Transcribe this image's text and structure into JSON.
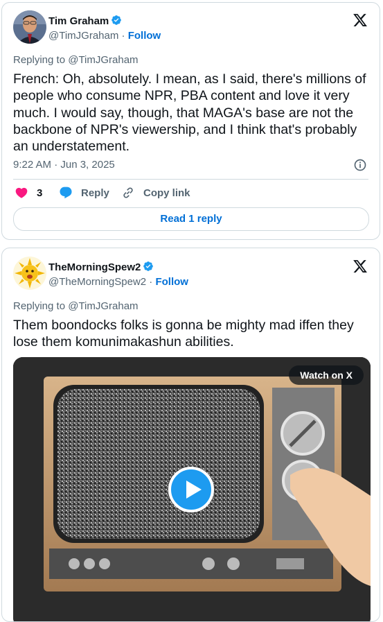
{
  "tweet1": {
    "author_name": "Tim Graham",
    "author_handle": "@TimJGraham",
    "separator": " · ",
    "follow_label": "Follow",
    "replying_to": "Replying to @TimJGraham",
    "text": "French: Oh, absolutely. I mean, as I said, there's millions of people who consume NPR, PBA content and love it very much. I would say, though, that MAGA's base are not the backbone of NPR's viewership, and I think that's probably an understatement.",
    "timestamp": "9:22 AM · Jun 3, 2025",
    "like_count": "3",
    "reply_label": "Reply",
    "copy_link_label": "Copy link",
    "read_replies_label": "Read 1 reply"
  },
  "tweet2": {
    "author_name": "TheMorningSpew2",
    "author_handle": "@TheMorningSpew2",
    "separator": " · ",
    "follow_label": "Follow",
    "replying_to": "Replying to @TimJGraham",
    "text": "Them boondocks folks is gonna be mighty mad iffen they lose them komunimakashun abilities.",
    "watch_label": "Watch on X"
  },
  "colors": {
    "link_blue": "#006fd6",
    "verified_blue": "#1d9bf0",
    "like_pink": "#f91880",
    "secondary_text": "#536471",
    "border": "#cfd9de"
  },
  "icons": [
    "verified-badge-icon",
    "x-logo-icon",
    "info-icon",
    "heart-icon",
    "reply-icon",
    "link-icon",
    "play-icon"
  ]
}
